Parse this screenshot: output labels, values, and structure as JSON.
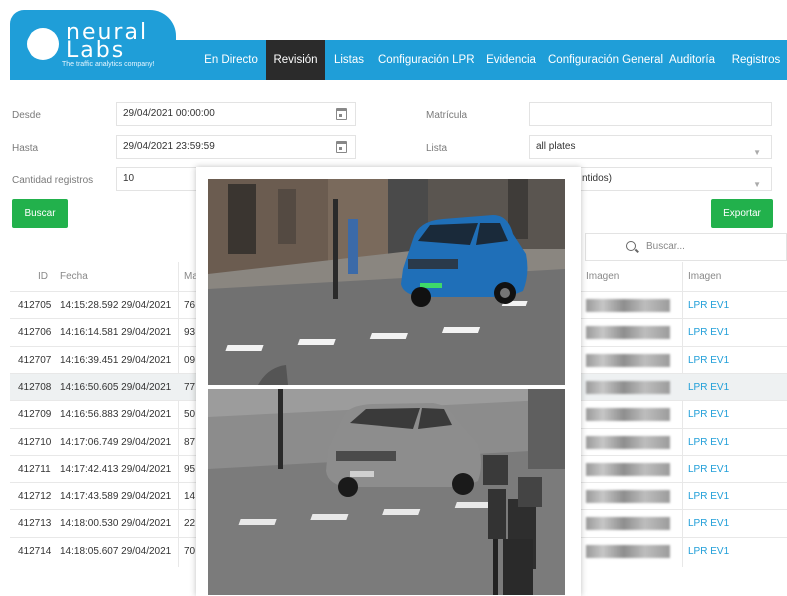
{
  "brand": {
    "logo_line1": "neural",
    "logo_line2": "Labs",
    "tagline": "The traffic analytics company!"
  },
  "nav": {
    "items": [
      "En Directo",
      "Revisión",
      "Listas",
      "Configuración LPR",
      "Evidencia",
      "Configuración General",
      "Auditoría",
      "Registros"
    ],
    "active": "Revisión"
  },
  "form": {
    "desde_label": "Desde",
    "desde_value": "29/04/2021 00:00:00",
    "hasta_label": "Hasta",
    "hasta_value": "29/04/2021 23:59:59",
    "cantidad_label": "Cantidad registros",
    "cantidad_value": "10",
    "matricula_label": "Matrícula",
    "matricula_value": "",
    "lista_label": "Lista",
    "lista_value": "all plates",
    "third_select_value": "ntidos)",
    "buscar_label": "Buscar",
    "exportar_label": "Exportar"
  },
  "search": {
    "placeholder": "Buscar..."
  },
  "table": {
    "headers": [
      "ID",
      "Fecha",
      "Ma",
      "Imagen",
      "Imagen"
    ],
    "rows": [
      {
        "id": "412705",
        "fecha": "14:15:28.592 29/04/2021",
        "m": "76",
        "link": "LPR EV1"
      },
      {
        "id": "412706",
        "fecha": "14:16:14.581 29/04/2021",
        "m": "93",
        "link": "LPR EV1"
      },
      {
        "id": "412707",
        "fecha": "14:16:39.451 29/04/2021",
        "m": "09",
        "link": "LPR EV1"
      },
      {
        "id": "412708",
        "fecha": "14:16:50.605 29/04/2021",
        "m": "77",
        "link": "LPR EV1"
      },
      {
        "id": "412709",
        "fecha": "14:16:56.883 29/04/2021",
        "m": "50",
        "link": "LPR EV1"
      },
      {
        "id": "412710",
        "fecha": "14:17:06.749 29/04/2021",
        "m": "87",
        "link": "LPR EV1"
      },
      {
        "id": "412711",
        "fecha": "14:17:42.413 29/04/2021",
        "m": "95",
        "link": "LPR EV1"
      },
      {
        "id": "412712",
        "fecha": "14:17:43.589 29/04/2021",
        "m": "14",
        "link": "LPR EV1"
      },
      {
        "id": "412713",
        "fecha": "14:18:00.530 29/04/2021",
        "m": "22",
        "link": "LPR EV1"
      },
      {
        "id": "412714",
        "fecha": "14:18:05.607 29/04/2021",
        "m": "70",
        "link": "LPR EV1"
      }
    ],
    "highlighted_row": 3
  },
  "colors": {
    "brand_blue": "#1f9ed8",
    "active_nav": "#2b2b2b",
    "green_button": "#22b14c",
    "car_blue": "#1f6fb8"
  }
}
